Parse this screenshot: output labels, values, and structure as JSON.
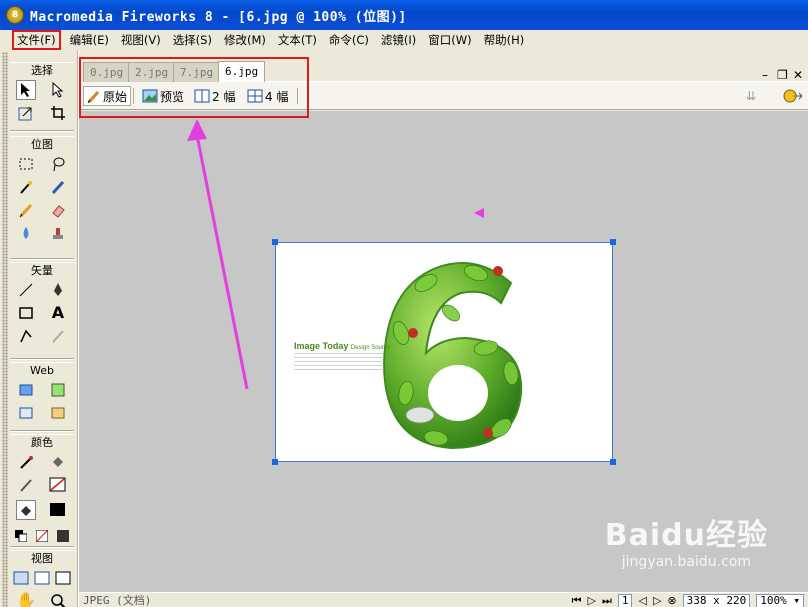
{
  "window": {
    "title": "Macromedia Fireworks 8 - [6.jpg @ 100% (位图)]",
    "app_icon_text": "8"
  },
  "menubar": [
    "文件(F)",
    "编辑(E)",
    "视图(V)",
    "选择(S)",
    "修改(M)",
    "文本(T)",
    "命令(C)",
    "滤镜(I)",
    "窗口(W)",
    "帮助(H)"
  ],
  "toolbox": {
    "sections": [
      "选择",
      "位图",
      "矢量",
      "Web",
      "颜色",
      "视图"
    ]
  },
  "tabs": [
    "0.jpg",
    "2.jpg",
    "7.jpg",
    "6.jpg"
  ],
  "active_tab": "6.jpg",
  "preview": {
    "original": "原始",
    "preview": "预览",
    "two_up": "2 幅",
    "four_up": "4 幅"
  },
  "image_text": {
    "heading": "Image Today",
    "sub": "Design Source"
  },
  "status": {
    "label": "JPEG (文档)",
    "frame": "1",
    "size": "338 x 220",
    "zoom": "100%"
  },
  "watermark": {
    "logo": "Baidu经验",
    "url": "jingyan.baidu.com"
  },
  "colors": {
    "annotation_red": "#e01818",
    "arrow_magenta": "#e23fe0",
    "title_blue": "#0a4fd6"
  }
}
